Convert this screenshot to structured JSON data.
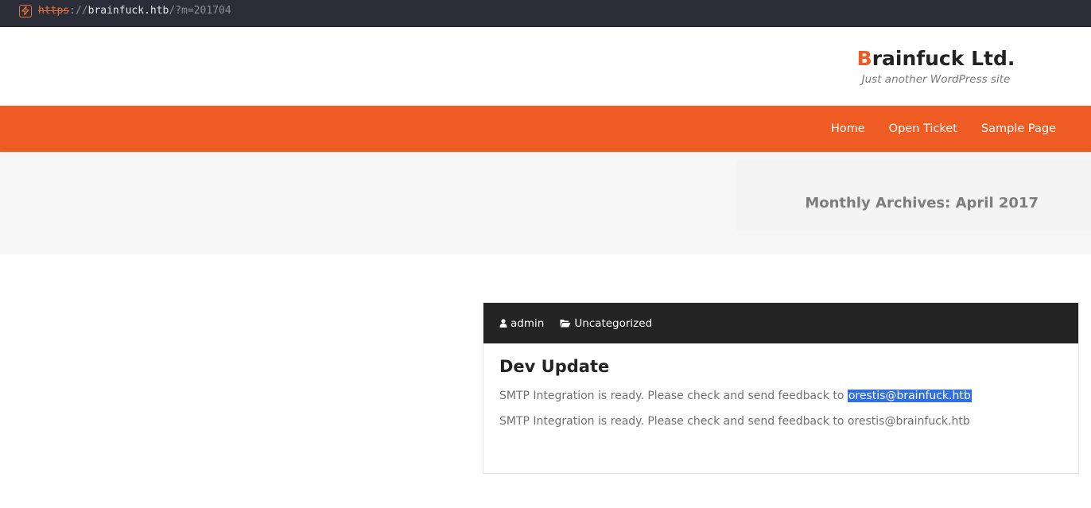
{
  "browser": {
    "url_scheme": "https",
    "url_separator": "://",
    "url_host": "brainfuck.htb",
    "url_path": "/?m=201704",
    "secure_icon": "lightning-shield-icon"
  },
  "site": {
    "title_initial": "B",
    "title_rest": "rainfuck Ltd.",
    "tagline": "Just another WordPress site",
    "accent_color": "#ee5b23"
  },
  "nav": {
    "items": [
      {
        "label": "Home"
      },
      {
        "label": "Open Ticket"
      },
      {
        "label": "Sample Page"
      }
    ]
  },
  "archive": {
    "title": "Monthly Archives: April 2017"
  },
  "post": {
    "author": "admin",
    "author_icon": "user-icon",
    "category": "Uncategorized",
    "category_icon": "folder-open-icon",
    "title": "Dev Update",
    "line1_text": "SMTP Integration is ready. Please check and send feedback to ",
    "line1_email": "orestis@brainfuck.htb",
    "line2_text": "SMTP Integration is ready. Please check and send feedback to orestis@brainfuck.htb"
  }
}
